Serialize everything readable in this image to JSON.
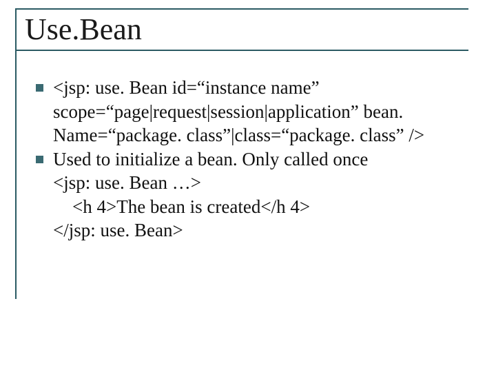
{
  "title": "Use.Bean",
  "bullets": [
    "<jsp: use. Bean id=“instance name” scope=“page|request|session|application” bean. Name=“package. class”|class=“package. class” />",
    "Used to initialize a bean. Only called once"
  ],
  "lines": [
    "<jsp: use. Bean …>",
    "<h 4>The bean is created</h 4>",
    "</jsp: use. Bean>"
  ]
}
